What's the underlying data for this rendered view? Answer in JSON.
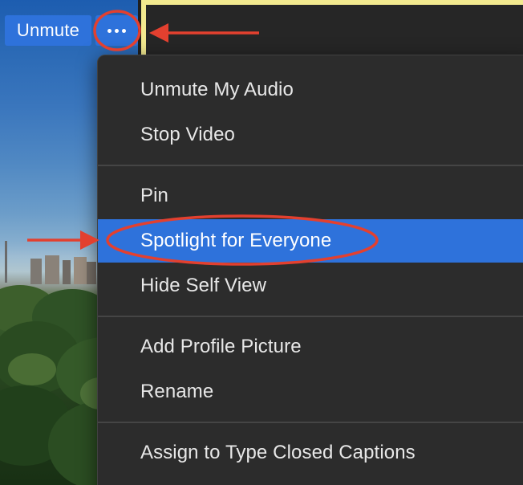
{
  "colors": {
    "accent": "#2e72db",
    "menu_background": "#2c2c2c",
    "menu_text": "#e7e7e7",
    "active_speaker_border": "#f2e98f",
    "annotation": "#e3402f"
  },
  "video_tile": {
    "unmute_label": "Unmute",
    "more_icon": "more-dots-icon"
  },
  "context_menu": {
    "sections": [
      {
        "items": [
          {
            "label": "Unmute My Audio",
            "highlighted": false
          },
          {
            "label": "Stop Video",
            "highlighted": false
          }
        ]
      },
      {
        "items": [
          {
            "label": "Pin",
            "highlighted": false
          },
          {
            "label": "Spotlight for Everyone",
            "highlighted": true
          },
          {
            "label": "Hide Self View",
            "highlighted": false
          }
        ]
      },
      {
        "items": [
          {
            "label": "Add Profile Picture",
            "highlighted": false
          },
          {
            "label": "Rename",
            "highlighted": false
          }
        ]
      },
      {
        "items": [
          {
            "label": "Assign to Type Closed Captions",
            "highlighted": false
          }
        ]
      }
    ]
  }
}
